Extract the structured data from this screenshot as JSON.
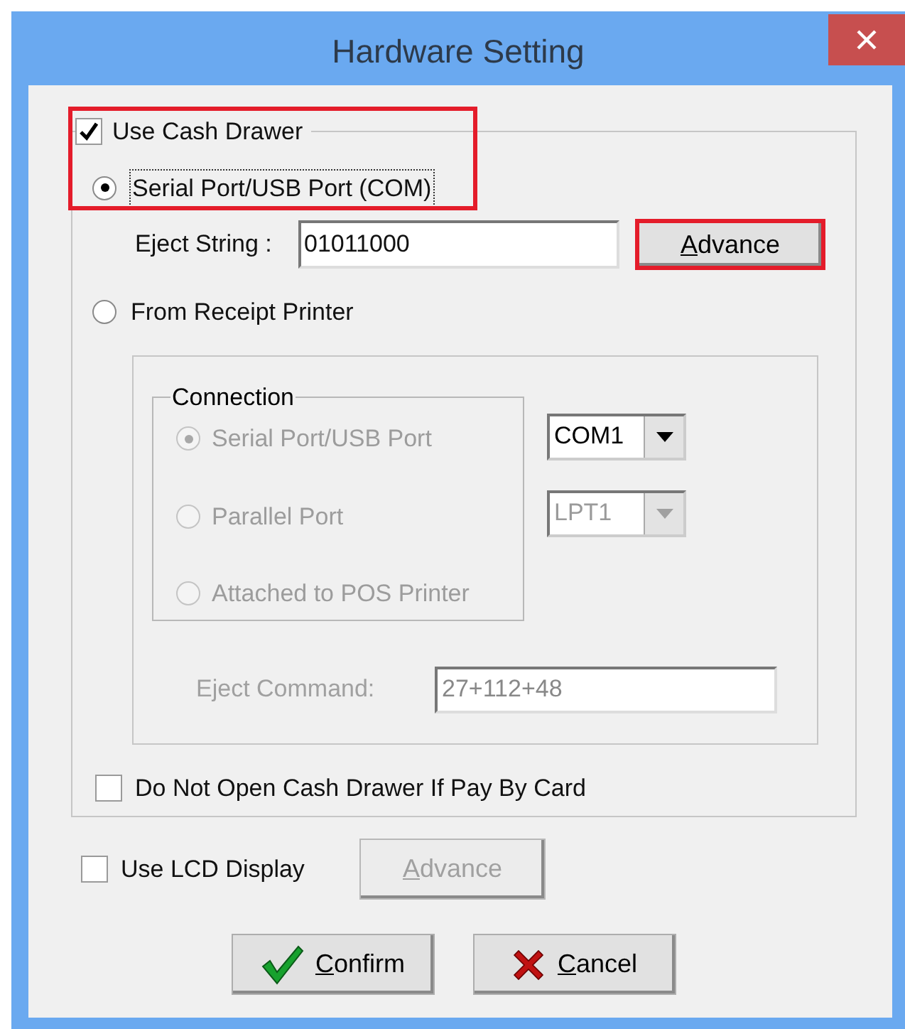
{
  "window": {
    "title": "Hardware Setting"
  },
  "cash_drawer": {
    "label": "Use Cash Drawer",
    "checked": true,
    "highlighted": true
  },
  "serial_option": {
    "label": "Serial Port/USB Port (COM)",
    "selected": true,
    "focused": true
  },
  "eject_string": {
    "label": "Eject String :",
    "value": "01011000"
  },
  "advance_button": {
    "label": "Advance",
    "highlighted": true,
    "disabled": false
  },
  "receipt_option": {
    "label": "From Receipt Printer",
    "selected": false
  },
  "connection": {
    "title": "Connection",
    "disabled": true,
    "options": [
      {
        "label": "Serial Port/USB Port",
        "selected": true
      },
      {
        "label": "Parallel Port",
        "selected": false
      },
      {
        "label": "Attached to POS Printer",
        "selected": false
      }
    ],
    "port_selects": [
      {
        "value": "COM1",
        "disabled": false
      },
      {
        "value": "LPT1",
        "disabled": true
      }
    ]
  },
  "eject_command": {
    "label": "Eject Command:",
    "value": "27+112+48",
    "disabled": true
  },
  "no_card_open": {
    "label": "Do Not Open Cash Drawer If Pay By Card",
    "checked": false
  },
  "lcd_display": {
    "label": "Use LCD Display",
    "checked": false
  },
  "lcd_advance_button": {
    "label": "Advance",
    "disabled": true
  },
  "buttons": [
    {
      "kind": "confirm",
      "label": "Confirm"
    },
    {
      "kind": "cancel",
      "label": "Cancel"
    }
  ]
}
